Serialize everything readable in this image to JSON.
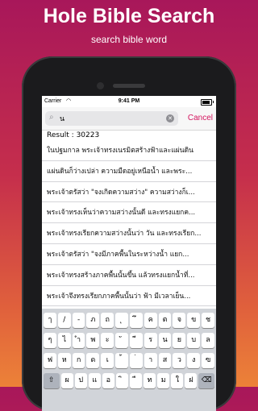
{
  "promo": {
    "title": "Hole Bible Search",
    "subtitle": "search bible word"
  },
  "status_bar": {
    "carrier": "Carrier",
    "time": "9:41 PM"
  },
  "search": {
    "value": "น",
    "cancel_label": "Cancel"
  },
  "results": {
    "count_label": "Result : 30223",
    "rows": [
      "ในปฐมกาล พระเจ้าทรงเนรมิตสร้างฟ้าและแผ่นดิน",
      "แผ่นดินก็ว่างเปล่า ความมืดอยู่เหนือน้ำ และพระ...",
      "พระเจ้าตรัสว่า \"จงเกิดความสว่าง\" ความสว่างก็เ...",
      "พระเจ้าทรงเห็นว่าความสว่างนั้นดี และทรงแยกค...",
      "พระเจ้าทรงเรียกความสว่างนั้นว่า วัน และทรงเรียก...",
      "พระเจ้าตรัสว่า \"จงมีภาคพื้นในระหว่างน้ำ แยก...",
      "พระเจ้าทรงสร้างภาคพื้นนั้นขึ้น แล้วทรงแยกน้ำที่...",
      "พระเจ้าจึงทรงเรียกภาคพื้นนั้นว่า ฟ้า มีเวลาเย็น..."
    ]
  },
  "keyboard": {
    "row1": [
      "ๅ",
      "/",
      "-",
      "ภ",
      "ถ",
      "ุ",
      "ึ",
      "ค",
      "ต",
      "จ",
      "ข",
      "ช"
    ],
    "row2": [
      "ๆ",
      "ไ",
      "ำ",
      "พ",
      "ะ",
      "ั",
      "ี",
      "ร",
      "น",
      "ย",
      "บ",
      "ล"
    ],
    "row3": [
      "ฟ",
      "ห",
      "ก",
      "ด",
      "เ",
      "้",
      "่",
      "า",
      "ส",
      "ว",
      "ง",
      "ฃ"
    ],
    "row4": [
      "⇧",
      "ผ",
      "ป",
      "แ",
      "อ",
      "ิ",
      "ื",
      "ท",
      "ม",
      "ใ",
      "ฝ",
      "⌫"
    ]
  }
}
